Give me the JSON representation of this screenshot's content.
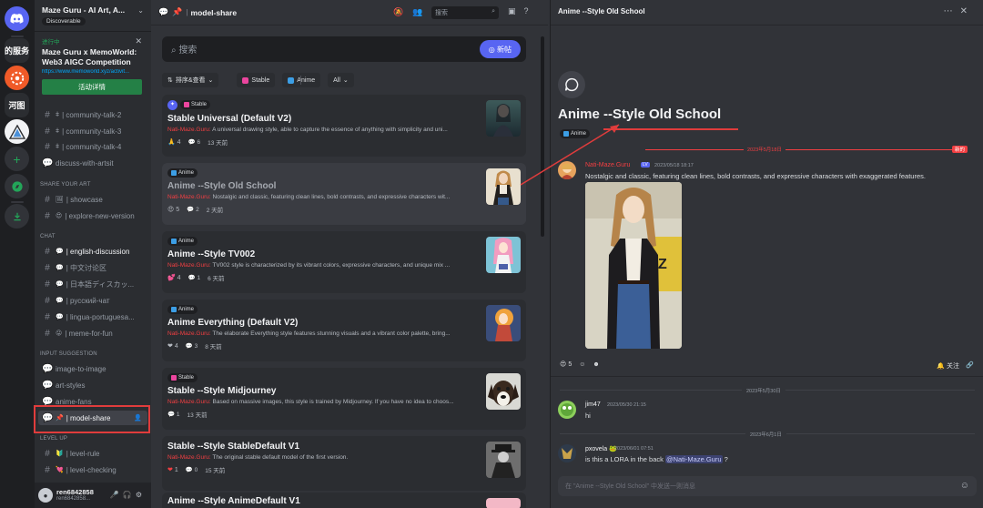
{
  "rail": {
    "servers": [
      "的服务",
      "河图"
    ]
  },
  "sidebar": {
    "server_name": "Maze Guru - AI Art, A...",
    "discoverable": "Discoverable",
    "event": {
      "status": "进行中",
      "title": "Maze Guru x MemoWorld: Web3 AIGC Competition",
      "link": "https://www.memoworld.xyz/activit...",
      "button": "活动详情"
    },
    "channels_top": [
      {
        "name": "community-talk-2"
      },
      {
        "name": "community-talk-3"
      },
      {
        "name": "community-talk-4"
      },
      {
        "name": "discuss-with-artsit"
      }
    ],
    "cat_share": "SHARE YOUR ART",
    "channels_share": [
      {
        "name": "showcase"
      },
      {
        "name": "explore-new-version"
      }
    ],
    "cat_chat": "CHAT",
    "channels_chat": [
      {
        "name": "english-discussion"
      },
      {
        "name": "中文讨论区"
      },
      {
        "name": "日本語ディスカッ..."
      },
      {
        "name": "русский-чат"
      },
      {
        "name": "lingua-portuguesa..."
      },
      {
        "name": "meme-for-fun"
      }
    ],
    "cat_input": "INPUT SUGGESTION",
    "channels_input": [
      {
        "name": "image-to-image"
      },
      {
        "name": "art-styles"
      },
      {
        "name": "anime-fans"
      },
      {
        "name": "model-share"
      }
    ],
    "cat_level": "LEVEL UP",
    "channels_level": [
      {
        "name": "level-rule"
      },
      {
        "name": "level-checking"
      }
    ],
    "user": {
      "name": "ren6842858",
      "tag": "ren6842858..."
    }
  },
  "forum": {
    "channel_name": "model-share",
    "header_search": "搜索",
    "search_placeholder": "搜索",
    "new_post": "新帖",
    "filters": {
      "sort": "排序&查看",
      "tag_stable": "Stable",
      "tag_anime": "Anime",
      "all": "All"
    },
    "posts": [
      {
        "tag": "Stable",
        "title": "Stable Universal (Default V2)",
        "author": "Nati-Maze.Guru:",
        "desc": " A universal drawing style, able to capture the essence of anything with simplicity and uni...",
        "reactions": "4",
        "replies": "6",
        "time": "13 天前"
      },
      {
        "tag": "Anime",
        "title": "Anime --Style Old School",
        "author": "Nati-Maze.Guru:",
        "desc": " Nostalgic and classic, featuring clean lines, bold contrasts, and expressive characters wit...",
        "reactions": "5",
        "replies": "2",
        "time": "2 天前"
      },
      {
        "tag": "Anime",
        "title": "Anime --Style TV002",
        "author": "Nati-Maze.Guru:",
        "desc": " TV002 style is characterized by its vibrant colors, expressive characters, and unique mix ...",
        "reactions": "4",
        "replies": "1",
        "time": "6 天前"
      },
      {
        "tag": "Anime",
        "title": "Anime Everything (Default V2)",
        "author": "Nati-Maze.Guru:",
        "desc": " The elaborate Everything style features stunning visuals and a vibrant color palette, bring...",
        "reactions": "4",
        "replies": "3",
        "time": "8 天前"
      },
      {
        "tag": "Stable",
        "title": "Stable --Style Midjourney",
        "author": "Nati-Maze.Guru:",
        "desc": " Based on massive images, this style is trained by Midjourney. If you have no idea to choos...",
        "reactions": "",
        "replies": "1",
        "time": "13 天前"
      },
      {
        "tag": "",
        "title": "Stable --Style StableDefault V1",
        "author": "Nati-Maze.Guru:",
        "desc": " The original stable default model of the first version.",
        "reactions": "1",
        "replies": "0",
        "time": "15 天前"
      },
      {
        "tag": "",
        "title": "Anime --Style AnimeDefault V1",
        "author": "",
        "desc": "",
        "reactions": "",
        "replies": "",
        "time": ""
      }
    ]
  },
  "thread": {
    "title": "Anime --Style Old School",
    "big_title": "Anime --Style Old School",
    "tag": "Anime",
    "date1": "2023年5月18日",
    "new_badge": "新的",
    "msg1": {
      "author": "Nati-Maze.Guru",
      "badge": "LV",
      "time": "2023/05/18 18:17",
      "text": "Nostalgic and classic, featuring clean lines, bold contrasts, and expressive characters with exaggerated features."
    },
    "reactions": {
      "heart": "5"
    },
    "follow": "关注",
    "date2": "2023年5月30日",
    "msg2": {
      "author": "jim47",
      "time": "2023/05/30 21:15",
      "text": "hi"
    },
    "date3": "2023年6月1日",
    "msg3": {
      "author": "pxovela",
      "time": "2023/06/01 07:51",
      "text": "is this a LORA in the back ",
      "mention": "@Nati-Maze.Guru",
      "tail": " ?"
    },
    "composer_placeholder": "在 \"Anime --Style Old School\" 中发送一则消息"
  },
  "colors": {
    "accent": "#5865f2",
    "highlight": "#e03c3c",
    "green": "#248046",
    "mention": "#f23f42"
  }
}
